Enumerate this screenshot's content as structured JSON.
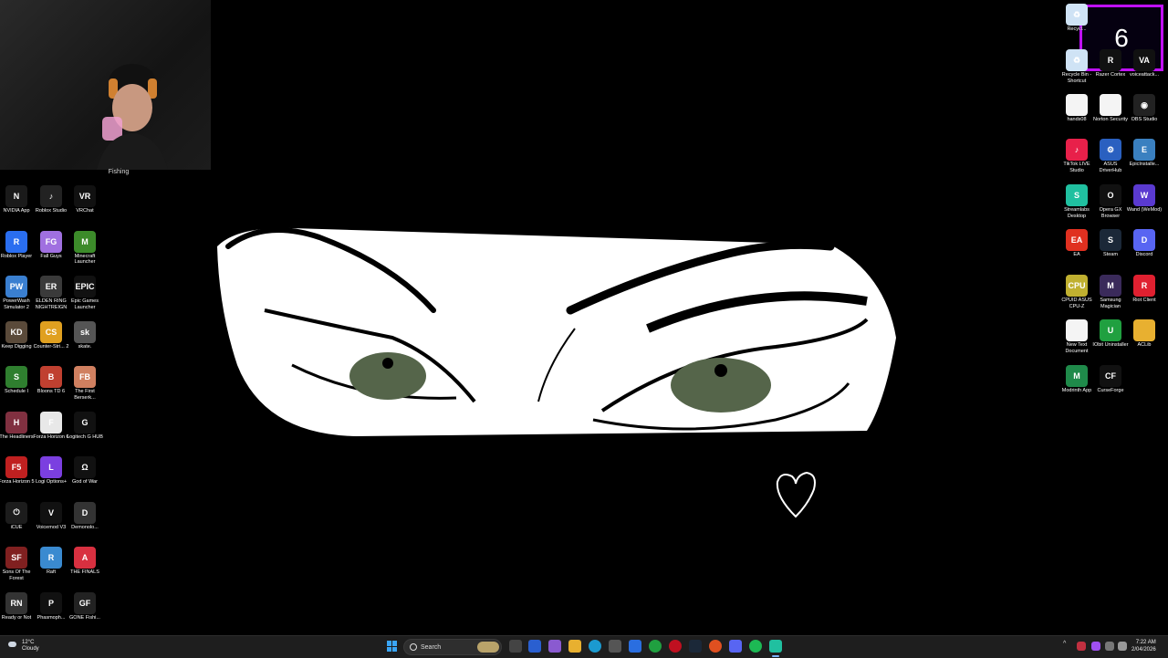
{
  "webcam": {
    "label": "Fishing"
  },
  "counter": {
    "value": "6"
  },
  "left_icons": [
    {
      "label": "NVIDIA App",
      "color": "#1a1a1a",
      "glyph": "N",
      "icon": "nvidia-icon"
    },
    {
      "label": "Roblox Studio",
      "color": "#222",
      "glyph": "♪",
      "icon": "roblox-studio-icon"
    },
    {
      "label": "VRChat",
      "color": "#111",
      "glyph": "VR",
      "icon": "vrchat-icon"
    },
    {
      "label": "Roblox Player",
      "color": "#2a6ef0",
      "glyph": "R",
      "icon": "roblox-player-icon"
    },
    {
      "label": "Fall Guys",
      "color": "#a070e0",
      "glyph": "FG",
      "icon": "fall-guys-icon"
    },
    {
      "label": "Minecraft Launcher",
      "color": "#3c8b2a",
      "glyph": "M",
      "icon": "minecraft-icon"
    },
    {
      "label": "PowerWash Simulator 2",
      "color": "#3a7fd0",
      "glyph": "PW",
      "icon": "powerwash-icon"
    },
    {
      "label": "ELDEN RING NIGHTREIGN",
      "color": "#3a3a3a",
      "glyph": "ER",
      "icon": "elden-ring-icon"
    },
    {
      "label": "Epic Games Launcher",
      "color": "#111",
      "glyph": "EPIC",
      "icon": "epic-games-icon"
    },
    {
      "label": "Keep Digging",
      "color": "#5a4a3a",
      "glyph": "KD",
      "icon": "keep-digging-icon"
    },
    {
      "label": "Counter-Stri... 2",
      "color": "#e0a020",
      "glyph": "CS",
      "icon": "counter-strike-icon"
    },
    {
      "label": "skate.",
      "color": "#555",
      "glyph": "sk",
      "icon": "skate-icon"
    },
    {
      "label": "Schedule I",
      "color": "#2f7f2f",
      "glyph": "S",
      "icon": "schedule-icon"
    },
    {
      "label": "Bloons TD 6",
      "color": "#c04030",
      "glyph": "B",
      "icon": "bloons-icon"
    },
    {
      "label": "The First Berserk...",
      "color": "#d08060",
      "glyph": "FB",
      "icon": "berserker-icon"
    },
    {
      "label": "The Headliners",
      "color": "#803040",
      "glyph": "H",
      "icon": "headliners-icon"
    },
    {
      "label": "Forza Horizon 6",
      "color": "#e8e8e8",
      "glyph": "F",
      "icon": "forza-6-icon"
    },
    {
      "label": "Logitech G HUB",
      "color": "#111",
      "glyph": "G",
      "icon": "logitech-icon"
    },
    {
      "label": "Forza Horizon 5",
      "color": "#c02020",
      "glyph": "F5",
      "icon": "forza-5-icon"
    },
    {
      "label": "Logi Options+",
      "color": "#7b3fe0",
      "glyph": "L",
      "icon": "logi-options-icon"
    },
    {
      "label": "God of War",
      "color": "#111",
      "glyph": "Ω",
      "icon": "god-of-war-icon"
    },
    {
      "label": "iCUE",
      "color": "#1c1c1c",
      "glyph": "⏻",
      "icon": "icue-icon"
    },
    {
      "label": "Voicemod V3",
      "color": "#111",
      "glyph": "V",
      "icon": "voicemod-icon"
    },
    {
      "label": "Demonolo...",
      "color": "#333",
      "glyph": "D",
      "icon": "demonologist-icon"
    },
    {
      "label": "Sons Of The Forest",
      "color": "#802020",
      "glyph": "SF",
      "icon": "sons-forest-icon"
    },
    {
      "label": "Raft",
      "color": "#3a8ad0",
      "glyph": "R",
      "icon": "raft-icon"
    },
    {
      "label": "THE FINALS",
      "color": "#d83040",
      "glyph": "A",
      "icon": "the-finals-icon"
    },
    {
      "label": "Ready or Not",
      "color": "#333",
      "glyph": "RN",
      "icon": "ready-or-not-icon"
    },
    {
      "label": "Phasmoph...",
      "color": "#111",
      "glyph": "P",
      "icon": "phasmophobia-icon"
    },
    {
      "label": "GONE Fishi...",
      "color": "#222",
      "glyph": "GF",
      "icon": "gone-fishing-icon"
    }
  ],
  "right_icons": [
    {
      "label": "Recycl...",
      "color": "#cfe3f5",
      "glyph": "♻",
      "icon": "recycle-bin-icon"
    },
    {
      "label": "Recycle Bin - Shortcut",
      "color": "#cfe3f5",
      "glyph": "♻",
      "icon": "recycle-bin-shortcut-icon"
    },
    {
      "label": "Razer Cortex",
      "color": "#111",
      "glyph": "R",
      "icon": "razer-cortex-icon"
    },
    {
      "label": "voiceattack...",
      "color": "#111",
      "glyph": "VA",
      "icon": "voiceattack-icon"
    },
    {
      "label": "hands08",
      "color": "#f4f4f4",
      "glyph": "",
      "icon": "file-icon"
    },
    {
      "label": "Norton Security",
      "color": "#f4f4f4",
      "glyph": "",
      "icon": "norton-icon"
    },
    {
      "label": "OBS Studio",
      "color": "#222",
      "glyph": "◉",
      "icon": "obs-icon"
    },
    {
      "label": "TikTok LIVE Studio",
      "color": "#e8204a",
      "glyph": "♪",
      "icon": "tiktok-icon"
    },
    {
      "label": "ASUS DriverHub",
      "color": "#2a60c0",
      "glyph": "⚙",
      "icon": "asus-driverhub-icon"
    },
    {
      "label": "EpicInstalle...",
      "color": "#3a80c0",
      "glyph": "E",
      "icon": "epic-installer-icon"
    },
    {
      "label": "Streamlabs Desktop",
      "color": "#20c0a0",
      "glyph": "S",
      "icon": "streamlabs-icon"
    },
    {
      "label": "Opera GX Browser",
      "color": "#111",
      "glyph": "O",
      "icon": "opera-gx-icon"
    },
    {
      "label": "Wand (WeMod)",
      "color": "#5a3ad0",
      "glyph": "W",
      "icon": "wemod-icon"
    },
    {
      "label": "EA",
      "color": "#e03020",
      "glyph": "EA",
      "icon": "ea-icon"
    },
    {
      "label": "Steam",
      "color": "#1b2838",
      "glyph": "S",
      "icon": "steam-icon"
    },
    {
      "label": "Discord",
      "color": "#5865f2",
      "glyph": "D",
      "icon": "discord-icon"
    },
    {
      "label": "CPUID ASUS CPU-Z",
      "color": "#c0b030",
      "glyph": "CPU",
      "icon": "cpuz-icon"
    },
    {
      "label": "Samsung Magician",
      "color": "#3a2a5a",
      "glyph": "M",
      "icon": "samsung-magician-icon"
    },
    {
      "label": "Riot Client",
      "color": "#e02030",
      "glyph": "R",
      "icon": "riot-client-icon"
    },
    {
      "label": "New Text Document",
      "color": "#f4f4f4",
      "glyph": "",
      "icon": "text-document-icon"
    },
    {
      "label": "IObit Uninstaller",
      "color": "#20a040",
      "glyph": "U",
      "icon": "iobit-icon"
    },
    {
      "label": "ACLib",
      "color": "#e8b030",
      "glyph": "",
      "icon": "folder-icon"
    },
    {
      "label": "Modrinth App",
      "color": "#1f8a4a",
      "glyph": "M",
      "icon": "modrinth-icon"
    },
    {
      "label": "CurseForge",
      "color": "#111",
      "glyph": "CF",
      "icon": "curseforge-icon"
    }
  ],
  "taskbar": {
    "weather_temp": "12°C",
    "weather_desc": "Cloudy",
    "search_placeholder": "Search",
    "time": "7:22 AM",
    "date": "2/04/2026"
  }
}
